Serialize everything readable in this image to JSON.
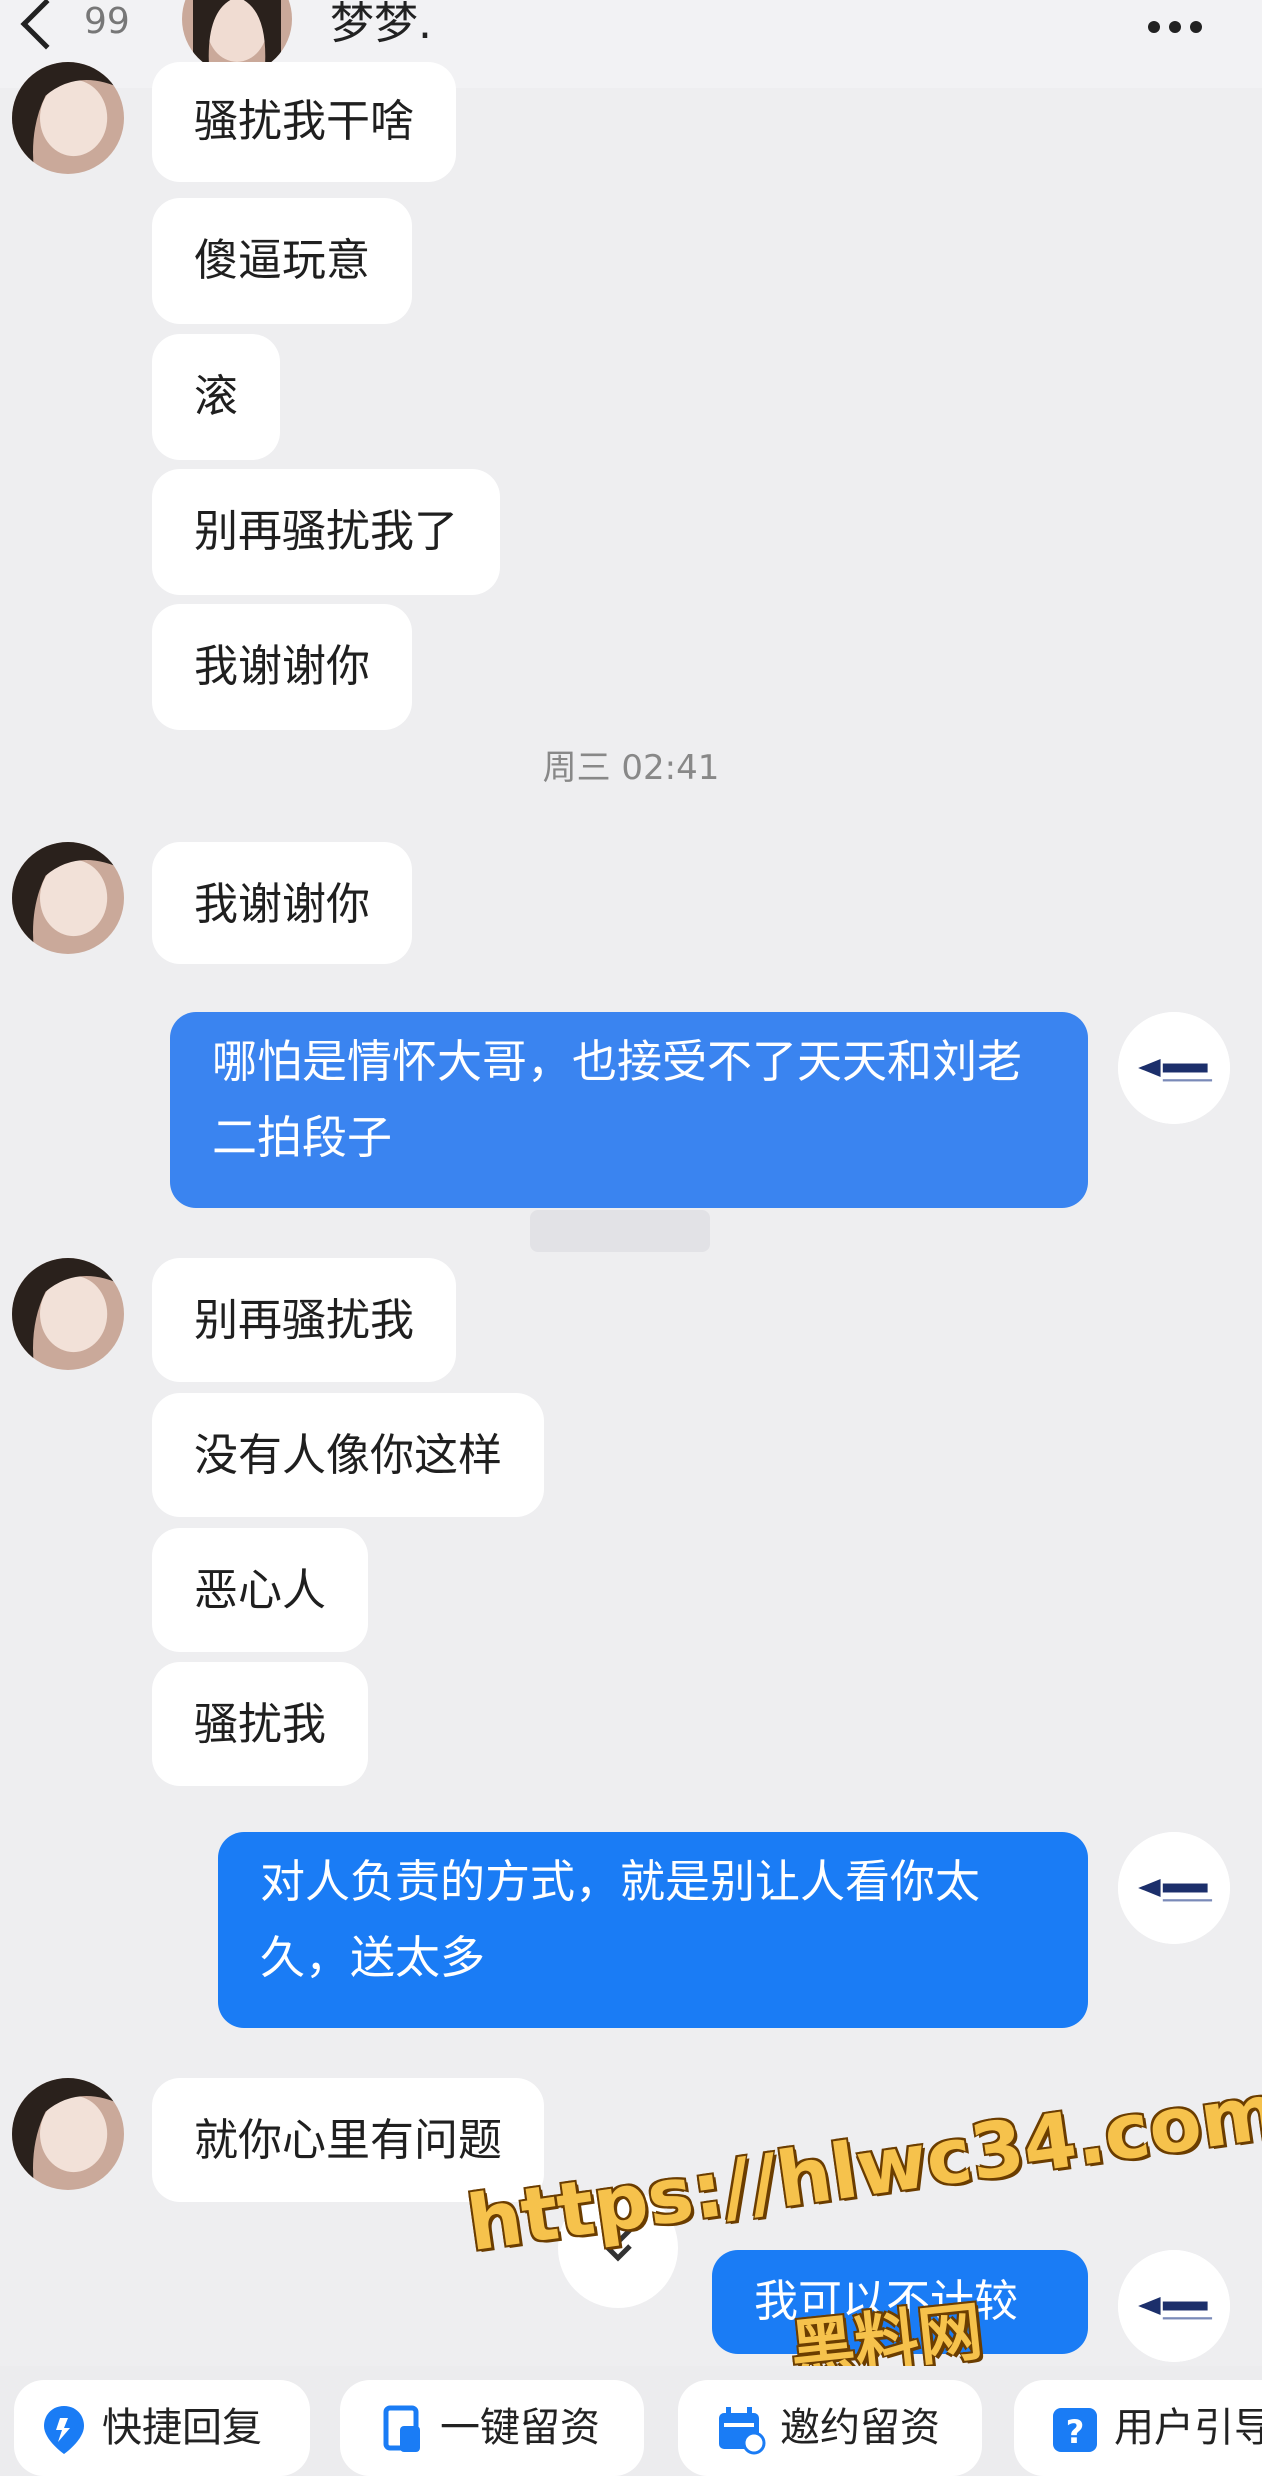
{
  "header": {
    "back_label": "<",
    "unread_count": "99",
    "contact_name": "梦梦.",
    "more_icon": "more-dots-icon"
  },
  "messages_top": [
    "骚扰我干啥",
    "傻逼玩意",
    "滚",
    "别再骚扰我了",
    "我谢谢你"
  ],
  "timestamp": "周三 02:41",
  "msg_after_ts": "我谢谢你",
  "outgoing_1": "哪怕是情怀大哥，也接受不了天天和刘老二拍段子",
  "messages_mid": [
    "别再骚扰我",
    "没有人像你这样",
    "恶心人",
    "骚扰我"
  ],
  "outgoing_2": "对人负责的方式，就是别让人看你太久，送太多",
  "msg_last": "就你心里有问题",
  "outgoing_3_partial": "我可以不计较",
  "quick_actions": [
    {
      "label": "快捷回复",
      "icon": "location-pin-icon"
    },
    {
      "label": "一键留资",
      "icon": "document-icon"
    },
    {
      "label": "邀约留资",
      "icon": "calendar-icon"
    },
    {
      "label": "用户引导",
      "icon": "help-icon"
    }
  ],
  "watermark": {
    "url": "https://hlwc34.com",
    "site": "黑料网"
  },
  "colors": {
    "outgoing": "#3a84f0",
    "background": "#eeeef0",
    "watermark": "#f6c24c"
  }
}
